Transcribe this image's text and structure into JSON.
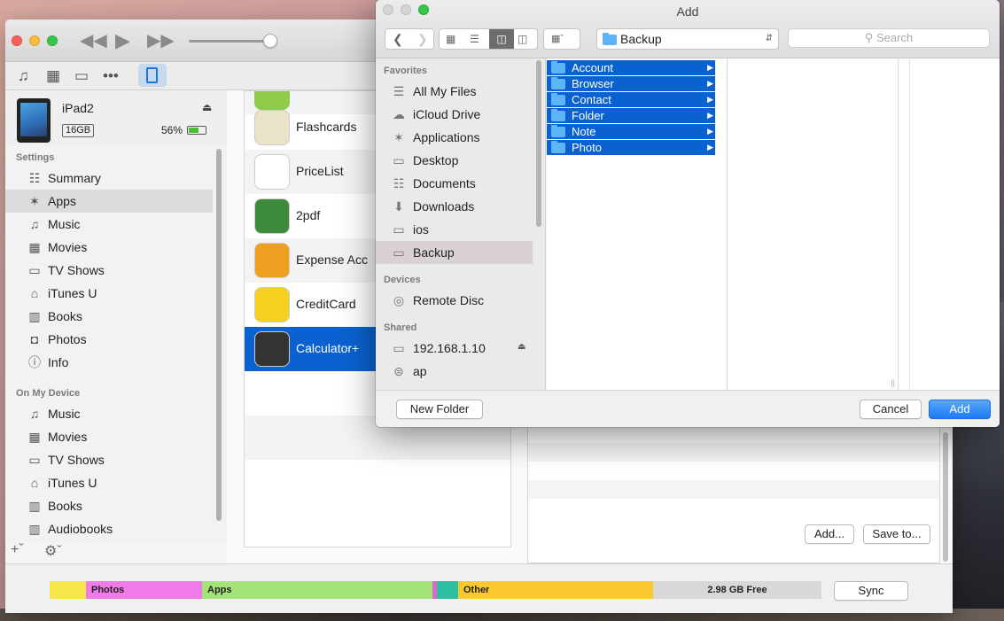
{
  "itunes": {
    "device": {
      "name": "iPad2",
      "capacity": "16GB",
      "battery": "56%"
    },
    "sidebar": {
      "settings_header": "Settings",
      "settings_items": [
        {
          "label": "Summary",
          "icon": "summary-icon"
        },
        {
          "label": "Apps",
          "icon": "apps-icon"
        },
        {
          "label": "Music",
          "icon": "music-icon"
        },
        {
          "label": "Movies",
          "icon": "movies-icon"
        },
        {
          "label": "TV Shows",
          "icon": "tv-icon"
        },
        {
          "label": "iTunes U",
          "icon": "itunes-u-icon"
        },
        {
          "label": "Books",
          "icon": "books-icon"
        },
        {
          "label": "Photos",
          "icon": "camera-icon"
        },
        {
          "label": "Info",
          "icon": "info-icon"
        }
      ],
      "device_header": "On My Device",
      "device_items": [
        {
          "label": "Music",
          "icon": "music-icon"
        },
        {
          "label": "Movies",
          "icon": "movies-icon"
        },
        {
          "label": "TV Shows",
          "icon": "tv-icon"
        },
        {
          "label": "iTunes U",
          "icon": "itunes-u-icon"
        },
        {
          "label": "Books",
          "icon": "books-icon"
        },
        {
          "label": "Audiobooks",
          "icon": "audiobooks-icon"
        }
      ]
    },
    "apps": [
      {
        "name": "Flashcards",
        "color": "#e8e4c8"
      },
      {
        "name": "PriceList",
        "color": "#ffffff"
      },
      {
        "name": "2pdf",
        "color": "#3c8a3a"
      },
      {
        "name": "Expense Acc",
        "color": "#f0a020"
      },
      {
        "name": "CreditCard",
        "color": "#f5d020"
      },
      {
        "name": "Calculator+",
        "color": "#333333"
      }
    ],
    "file_buttons": {
      "add": "Add...",
      "save": "Save to..."
    },
    "capacity_bar": [
      {
        "label": "",
        "color": "#f6e64c",
        "fraction": 0.047
      },
      {
        "label": "Photos",
        "color": "#f07ae8",
        "fraction": 0.151
      },
      {
        "label": "Apps",
        "color": "#a4e37a",
        "fraction": 0.298
      },
      {
        "label": "",
        "color": "#d86ac9",
        "fraction": 0.006
      },
      {
        "label": "",
        "color": "#2cbfa0",
        "fraction": 0.027
      },
      {
        "label": "Other",
        "color": "#fcc830",
        "fraction": 0.253
      },
      {
        "label": "2.98 GB Free",
        "color": "#d8d8d8",
        "fraction": 0.218
      }
    ],
    "sync_label": "Sync"
  },
  "dialog": {
    "title": "Add",
    "path_label": "Backup",
    "search_placeholder": "Search",
    "favorites_header": "Favorites",
    "favorites": [
      {
        "label": "All My Files",
        "icon": "all-files-icon"
      },
      {
        "label": "iCloud Drive",
        "icon": "cloud-icon"
      },
      {
        "label": "Applications",
        "icon": "applications-icon"
      },
      {
        "label": "Desktop",
        "icon": "desktop-icon"
      },
      {
        "label": "Documents",
        "icon": "documents-icon"
      },
      {
        "label": "Downloads",
        "icon": "downloads-icon"
      },
      {
        "label": "ios",
        "icon": "folder-icon"
      },
      {
        "label": "Backup",
        "icon": "folder-icon"
      }
    ],
    "devices_header": "Devices",
    "devices": [
      {
        "label": "Remote Disc",
        "icon": "disc-icon"
      }
    ],
    "shared_header": "Shared",
    "shared": [
      {
        "label": "192.168.1.10",
        "icon": "server-icon"
      },
      {
        "label": "ap",
        "icon": "network-drive-icon"
      }
    ],
    "folders": [
      "Account",
      "Browser",
      "Contact",
      "Folder",
      "Note",
      "Photo"
    ],
    "buttons": {
      "new_folder": "New Folder",
      "cancel": "Cancel",
      "add": "Add"
    }
  }
}
